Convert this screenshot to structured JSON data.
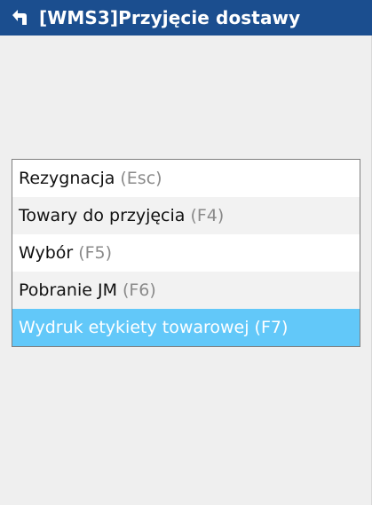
{
  "window": {
    "title": "[WMS3]Przyjęcie dostawy",
    "icon": "return-arrow-icon"
  },
  "menu": {
    "items": [
      {
        "label": "Rezygnacja",
        "shortcut": "(Esc)"
      },
      {
        "label": "Towary do przyjęcia",
        "shortcut": "(F4)"
      },
      {
        "label": "Wybór",
        "shortcut": "(F5)"
      },
      {
        "label": "Pobranie JM",
        "shortcut": "(F6)"
      },
      {
        "label": "Wydruk etykiety towarowej",
        "shortcut": "(F7)",
        "selected": true
      }
    ]
  },
  "colors": {
    "titlebar": "#1b4e8f",
    "selection": "#62c8f9",
    "shortcut_text": "#8a8a8a"
  }
}
